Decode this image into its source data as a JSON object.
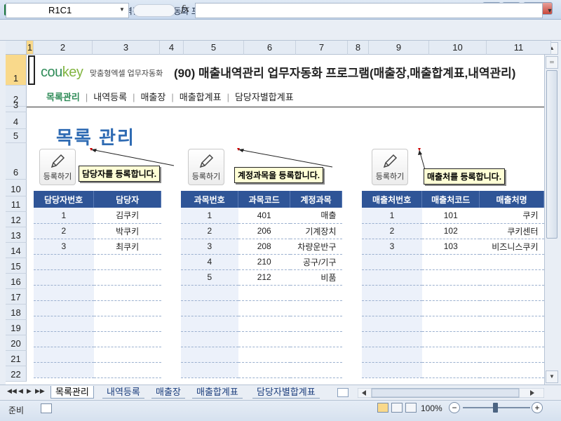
{
  "window": {
    "title": "Microsoft Excel - (90) 매출내역관리 업무자동화 프로그램(매출장,매출합계표,내역관리).xlsm",
    "app_icon": "X",
    "minimize_glyph": "▁",
    "restore_glyph": "❐",
    "close_glyph": "✕"
  },
  "formula_bar": {
    "name_box": "R1C1",
    "fx_label": "fx",
    "formula_value": ""
  },
  "columns": [
    "1",
    "2",
    "3",
    "4",
    "5",
    "6",
    "7",
    "8",
    "9",
    "10",
    "11"
  ],
  "rows": [
    "1",
    "2",
    "3",
    "4",
    "5",
    "6",
    "10",
    "11",
    "12",
    "13",
    "14",
    "15",
    "16",
    "17",
    "18",
    "19",
    "20",
    "21",
    "22"
  ],
  "sheet": {
    "logo_main": "cou",
    "logo_key": "key",
    "logo_sub": "맞춤형엑셀 업무자동화",
    "title": "(90) 매출내역관리 업무자동화 프로그램(매출장,매출합계표,내역관리)",
    "nav": [
      "목록관리",
      "내역등록",
      "매출장",
      "매출합계표",
      "담당자별합계표"
    ],
    "nav_separator": "|",
    "heading": "목록 관리",
    "register_label": "등록하기",
    "callouts": {
      "manager": "담당자를 등록합니다.",
      "account": "계정과목을 등록합니다.",
      "client": "매출처를 등록합니다."
    },
    "manager_table": {
      "headers": [
        "담당자번호",
        "담당자"
      ],
      "rows": [
        [
          "1",
          "김쿠키"
        ],
        [
          "2",
          "박쿠키"
        ],
        [
          "3",
          "최쿠키"
        ],
        [
          "",
          ""
        ],
        [
          "",
          ""
        ],
        [
          "",
          ""
        ],
        [
          "",
          ""
        ],
        [
          "",
          ""
        ],
        [
          "",
          ""
        ],
        [
          "",
          ""
        ],
        [
          "",
          ""
        ]
      ]
    },
    "account_table": {
      "headers": [
        "과목번호",
        "과목코드",
        "계정과목"
      ],
      "rows": [
        [
          "1",
          "401",
          "매출"
        ],
        [
          "2",
          "206",
          "기계장치"
        ],
        [
          "3",
          "208",
          "차량운반구"
        ],
        [
          "4",
          "210",
          "공구/기구"
        ],
        [
          "5",
          "212",
          "비품"
        ],
        [
          "",
          "",
          ""
        ],
        [
          "",
          "",
          ""
        ],
        [
          "",
          "",
          ""
        ],
        [
          "",
          "",
          ""
        ],
        [
          "",
          "",
          ""
        ],
        [
          "",
          "",
          ""
        ]
      ]
    },
    "client_table": {
      "headers": [
        "매출처번호",
        "매출처코드",
        "매출처명"
      ],
      "rows": [
        [
          "1",
          "101",
          "쿠키"
        ],
        [
          "2",
          "102",
          "쿠키센터"
        ],
        [
          "3",
          "103",
          "비즈니스쿠키"
        ],
        [
          "",
          "",
          ""
        ],
        [
          "",
          "",
          ""
        ],
        [
          "",
          "",
          ""
        ],
        [
          "",
          "",
          ""
        ],
        [
          "",
          "",
          ""
        ],
        [
          "",
          "",
          ""
        ],
        [
          "",
          "",
          ""
        ],
        [
          "",
          "",
          ""
        ]
      ]
    }
  },
  "sheet_tabs": [
    "목록관리",
    "내역등록",
    "매출장",
    "매출합계표",
    "담당자별합계표"
  ],
  "active_tab": "목록관리",
  "status": {
    "ready": "준비",
    "zoom": "100%",
    "zoom_level_percent": 100
  },
  "colors": {
    "header_blue": "#2f5597",
    "heading_blue": "#2f6bb3",
    "brand_green": "#2e8b57",
    "callout_bg": "#ffffd6",
    "selection_orange": "#f9d98b"
  },
  "icons": {
    "pencil": "pencil-icon",
    "tab_first": "◀◀",
    "tab_prev": "◀",
    "tab_next": "▶",
    "tab_last": "▶▶"
  }
}
